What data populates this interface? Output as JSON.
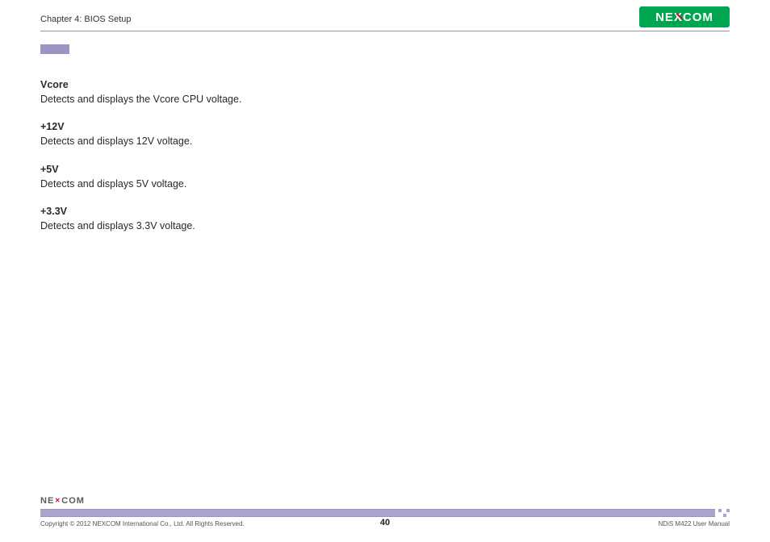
{
  "header": {
    "chapter_title": "Chapter 4: BIOS Setup",
    "logo_name": "NEXCOM"
  },
  "content": {
    "sections": [
      {
        "title": "Vcore",
        "desc": "Detects and displays the Vcore CPU voltage."
      },
      {
        "title": "+12V",
        "desc": "Detects and displays 12V voltage."
      },
      {
        "title": "+5V",
        "desc": "Detects and displays 5V voltage."
      },
      {
        "title": "+3.3V",
        "desc": "Detects and displays 3.3V voltage."
      }
    ]
  },
  "footer": {
    "logo_name": "NEXCOM",
    "copyright": "Copyright © 2012 NEXCOM International Co., Ltd. All Rights Reserved.",
    "page_number": "40",
    "doc_ref": "NDiS M422 User Manual"
  }
}
